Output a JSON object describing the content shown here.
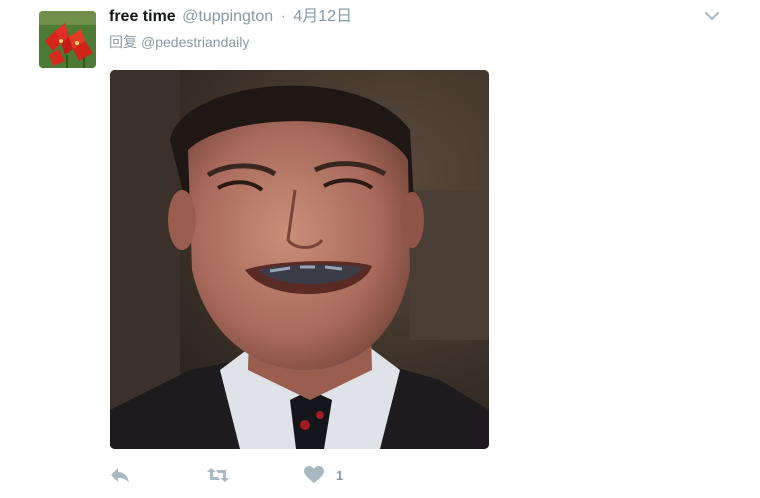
{
  "tweet": {
    "display_name": "free time",
    "handle": "@tuppington",
    "separator": "·",
    "timestamp": "4月12日",
    "reply_prefix": "回复",
    "reply_to": "@pedestriandaily",
    "avatar_icon": "red-flowers-avatar",
    "media_description_icon": "photo-media",
    "actions": {
      "reply_icon": "reply-icon",
      "retweet_icon": "retweet-icon",
      "like_icon": "heart-icon",
      "like_count": "1"
    },
    "colors": {
      "name": "#14171a",
      "muted": "#8899a6",
      "icon": "#aab8c2"
    }
  }
}
